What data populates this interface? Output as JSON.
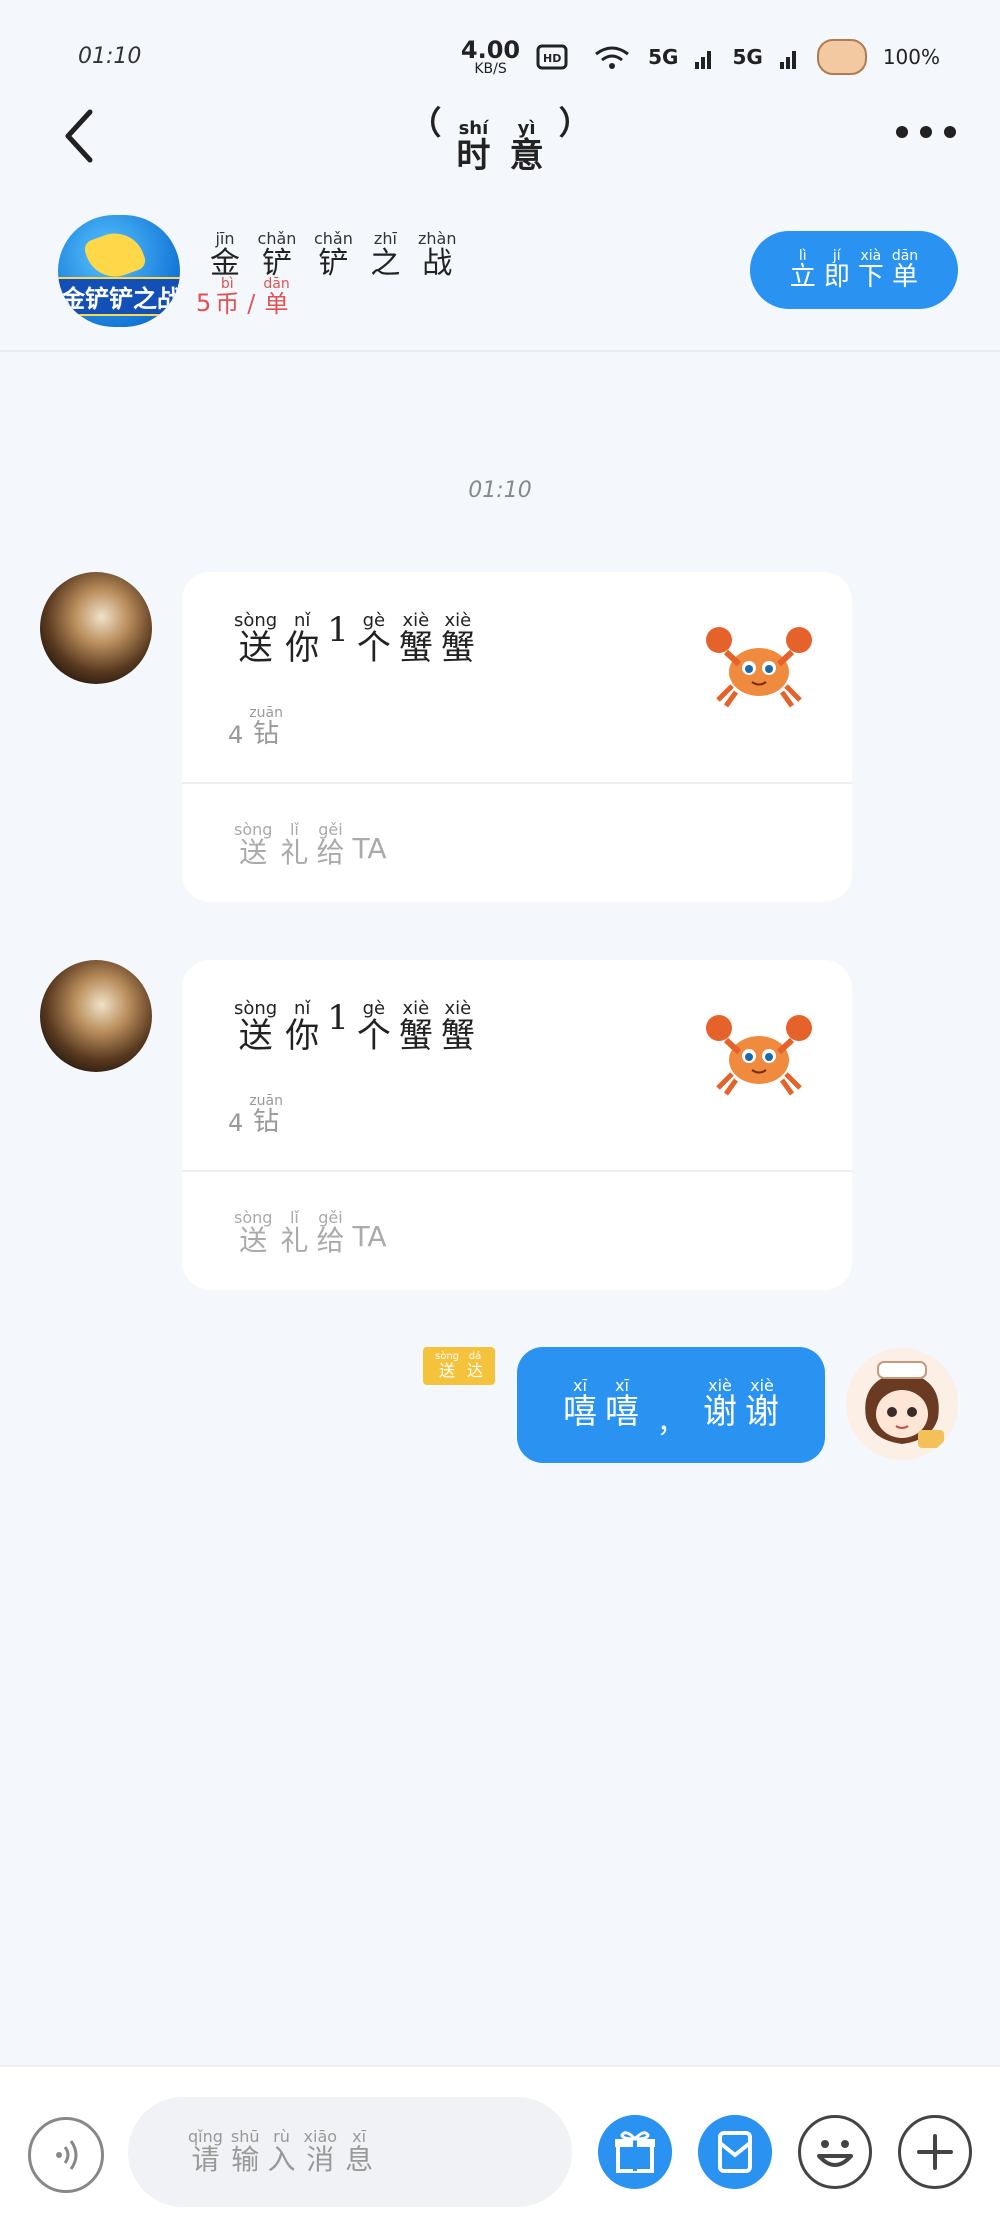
{
  "status_bar": {
    "time": "01:10",
    "speed_value": "4.00",
    "speed_unit": "KB/S",
    "battery": "100%",
    "network": "5G"
  },
  "header": {
    "title": [
      {
        "pinyin": "shí",
        "hanzi": "时"
      },
      {
        "pinyin": "yì",
        "hanzi": "意"
      }
    ],
    "title_open": "（",
    "title_close": "）"
  },
  "banner": {
    "game_logo_text": "金铲铲之战",
    "game_name": [
      {
        "pinyin": "jīn",
        "hanzi": "金"
      },
      {
        "pinyin": "chǎn",
        "hanzi": "铲"
      },
      {
        "pinyin": "chǎn",
        "hanzi": "铲"
      },
      {
        "pinyin": "zhī",
        "hanzi": "之"
      },
      {
        "pinyin": "zhàn",
        "hanzi": "战"
      }
    ],
    "price_number": "5",
    "price": [
      {
        "pinyin": "bì",
        "hanzi": "币"
      },
      {
        "pinyin": "",
        "hanzi": "/"
      },
      {
        "pinyin": "dān",
        "hanzi": "单"
      }
    ],
    "order_button": [
      {
        "pinyin": "lì",
        "hanzi": "立"
      },
      {
        "pinyin": "jí",
        "hanzi": "即"
      },
      {
        "pinyin": "xià",
        "hanzi": "下"
      },
      {
        "pinyin": "dān",
        "hanzi": "单"
      }
    ]
  },
  "chat": {
    "timestamp": "01:10",
    "gift_cards": [
      {
        "title": [
          {
            "pinyin": "sòng",
            "hanzi": "送"
          },
          {
            "pinyin": "nǐ",
            "hanzi": "你"
          },
          {
            "pinyin": "",
            "hanzi": "1"
          },
          {
            "pinyin": "gè",
            "hanzi": "个"
          },
          {
            "pinyin": "xiè",
            "hanzi": "蟹"
          },
          {
            "pinyin": "xiè",
            "hanzi": "蟹"
          }
        ],
        "price_number": "4",
        "price_unit": {
          "pinyin": "zuān",
          "hanzi": "钻"
        },
        "action": [
          {
            "pinyin": "sòng",
            "hanzi": "送"
          },
          {
            "pinyin": "lǐ",
            "hanzi": "礼"
          },
          {
            "pinyin": "gěi",
            "hanzi": "给"
          }
        ],
        "action_suffix": "TA",
        "gift_icon": "crab-icon"
      },
      {
        "title": [
          {
            "pinyin": "sòng",
            "hanzi": "送"
          },
          {
            "pinyin": "nǐ",
            "hanzi": "你"
          },
          {
            "pinyin": "",
            "hanzi": "1"
          },
          {
            "pinyin": "gè",
            "hanzi": "个"
          },
          {
            "pinyin": "xiè",
            "hanzi": "蟹"
          },
          {
            "pinyin": "xiè",
            "hanzi": "蟹"
          }
        ],
        "price_number": "4",
        "price_unit": {
          "pinyin": "zuān",
          "hanzi": "钻"
        },
        "action": [
          {
            "pinyin": "sòng",
            "hanzi": "送"
          },
          {
            "pinyin": "lǐ",
            "hanzi": "礼"
          },
          {
            "pinyin": "gěi",
            "hanzi": "给"
          }
        ],
        "action_suffix": "TA",
        "gift_icon": "crab-icon"
      }
    ],
    "my_message": {
      "badge": [
        {
          "pinyin": "sòng",
          "hanzi": "送"
        },
        {
          "pinyin": "dá",
          "hanzi": "达"
        }
      ],
      "part1": [
        {
          "pinyin": "xī",
          "hanzi": "嘻"
        },
        {
          "pinyin": "xī",
          "hanzi": "嘻"
        }
      ],
      "comma": "，",
      "part2": [
        {
          "pinyin": "xiè",
          "hanzi": "谢"
        },
        {
          "pinyin": "xiè",
          "hanzi": "谢"
        }
      ]
    }
  },
  "input_bar": {
    "placeholder": [
      {
        "pinyin": "qǐng",
        "hanzi": "请"
      },
      {
        "pinyin": "shū",
        "hanzi": "输"
      },
      {
        "pinyin": "rù",
        "hanzi": "入"
      },
      {
        "pinyin": "xiāo",
        "hanzi": "消"
      },
      {
        "pinyin": "xī",
        "hanzi": "息"
      }
    ]
  },
  "colors": {
    "accent": "#2a92f0",
    "badge": "#f5c33b",
    "price_red": "#e05252",
    "background": "#f4f7fb"
  }
}
